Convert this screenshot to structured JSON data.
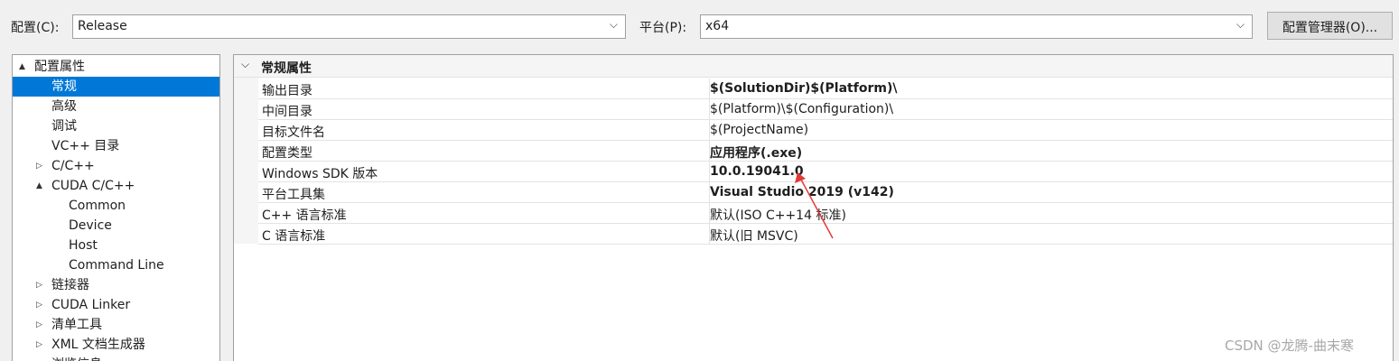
{
  "toolbar": {
    "config_label": "配置(C):",
    "config_value": "Release",
    "platform_label": "平台(P):",
    "platform_value": "x64",
    "manager_button": "配置管理器(O)..."
  },
  "tree": {
    "items": [
      {
        "label": "配置属性",
        "expander": "▲",
        "selected": false
      },
      {
        "label": "常规",
        "expander": "",
        "selected": true
      },
      {
        "label": "高级",
        "expander": "",
        "selected": false
      },
      {
        "label": "调试",
        "expander": "",
        "selected": false
      },
      {
        "label": "VC++ 目录",
        "expander": "",
        "selected": false
      },
      {
        "label": "C/C++",
        "expander": "▷",
        "selected": false
      },
      {
        "label": "CUDA C/C++",
        "expander": "▲",
        "selected": false
      },
      {
        "label": "Common",
        "expander": "",
        "selected": false
      },
      {
        "label": "Device",
        "expander": "",
        "selected": false
      },
      {
        "label": "Host",
        "expander": "",
        "selected": false
      },
      {
        "label": "Command Line",
        "expander": "",
        "selected": false
      },
      {
        "label": "链接器",
        "expander": "▷",
        "selected": false
      },
      {
        "label": "CUDA Linker",
        "expander": "▷",
        "selected": false
      },
      {
        "label": "清单工具",
        "expander": "▷",
        "selected": false
      },
      {
        "label": "XML 文档生成器",
        "expander": "▷",
        "selected": false
      },
      {
        "label": "浏览信息",
        "expander": "▷",
        "selected": false
      }
    ]
  },
  "grid": {
    "section_title": "常规属性",
    "rows": [
      {
        "name": "输出目录",
        "value": "$(SolutionDir)$(Platform)\\",
        "bold": true
      },
      {
        "name": "中间目录",
        "value": "$(Platform)\\$(Configuration)\\",
        "bold": false
      },
      {
        "name": "目标文件名",
        "value": "$(ProjectName)",
        "bold": false
      },
      {
        "name": "配置类型",
        "value": "应用程序(.exe)",
        "bold": true
      },
      {
        "name": "Windows SDK 版本",
        "value": "10.0.19041.0",
        "bold": true
      },
      {
        "name": "平台工具集",
        "value": "Visual Studio 2019 (v142)",
        "bold": true
      },
      {
        "name": "C++ 语言标准",
        "value": "默认(ISO C++14 标准)",
        "bold": false
      },
      {
        "name": "C 语言标准",
        "value": "默认(旧 MSVC)",
        "bold": false
      }
    ]
  },
  "watermark": "CSDN @龙腾-曲末寒",
  "colors": {
    "selection": "#0078d7",
    "annotation_arrow": "#e53935"
  }
}
